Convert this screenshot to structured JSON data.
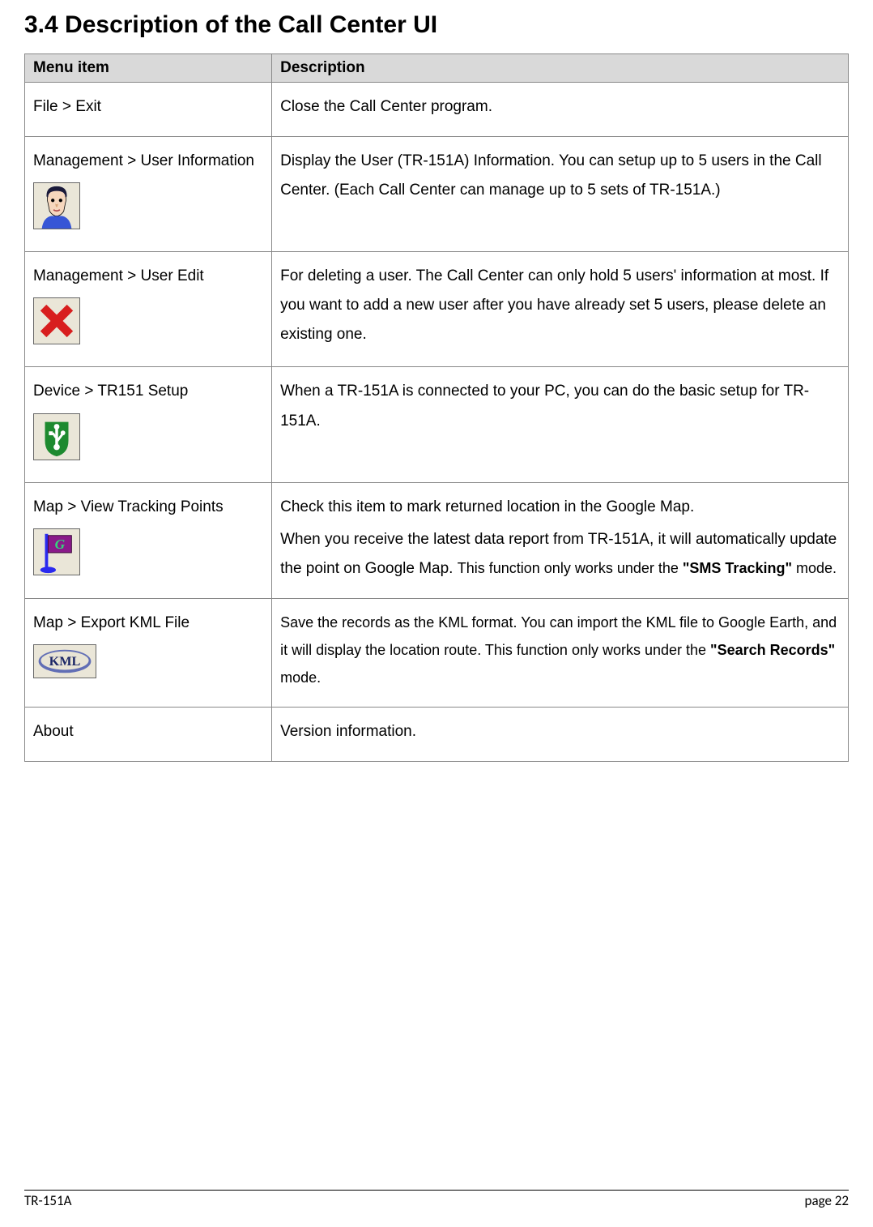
{
  "heading": "3.4 Description of the Call Center UI",
  "table": {
    "headers": {
      "menu": "Menu item",
      "desc": "Description"
    },
    "rows": [
      {
        "menu": "File > Exit",
        "desc": "Close the Call Center program.",
        "icon": null
      },
      {
        "menu": "Management > User Information",
        "desc": "Display the User (TR-151A) Information. You can setup up to 5 users in the Call Center. (Each Call Center can manage up to 5 sets of TR-151A.)",
        "icon": "user-head-icon"
      },
      {
        "menu": "Management > User Edit",
        "desc": "For deleting a user. The Call Center can only hold 5 users' information at most. If you want to add a new user after you have already set 5 users, please delete an existing one.",
        "icon": "red-x-icon"
      },
      {
        "menu": "Device > TR151 Setup",
        "desc": "When a TR-151A is connected to your PC, you can do the basic setup for TR-151A.",
        "icon": "usb-shield-icon"
      },
      {
        "menu": "Map > View Tracking Points",
        "desc_parts": {
          "p1": "Check this item to mark returned location in the Google Map.",
          "p2a": "When you receive the latest data report from TR-151A, it will automatically update the point on Google Map. ",
          "p2b": "This function only works under the ",
          "p2c": "\"SMS Tracking\"",
          "p2d": " mode."
        },
        "icon": "g-flag-icon"
      },
      {
        "menu": "Map > Export KML File",
        "desc_parts": {
          "a": "Save the records as the KML format. You can import the KML file to Google Earth, and it will display the location route. This function only works under the ",
          "b": "\"Search Records\"",
          "c": " mode."
        },
        "icon": "kml-icon",
        "icon_text": "KML"
      },
      {
        "menu": "About",
        "desc": "Version information.",
        "icon": null
      }
    ]
  },
  "footer": {
    "left": "TR-151A",
    "right": "page 22"
  }
}
